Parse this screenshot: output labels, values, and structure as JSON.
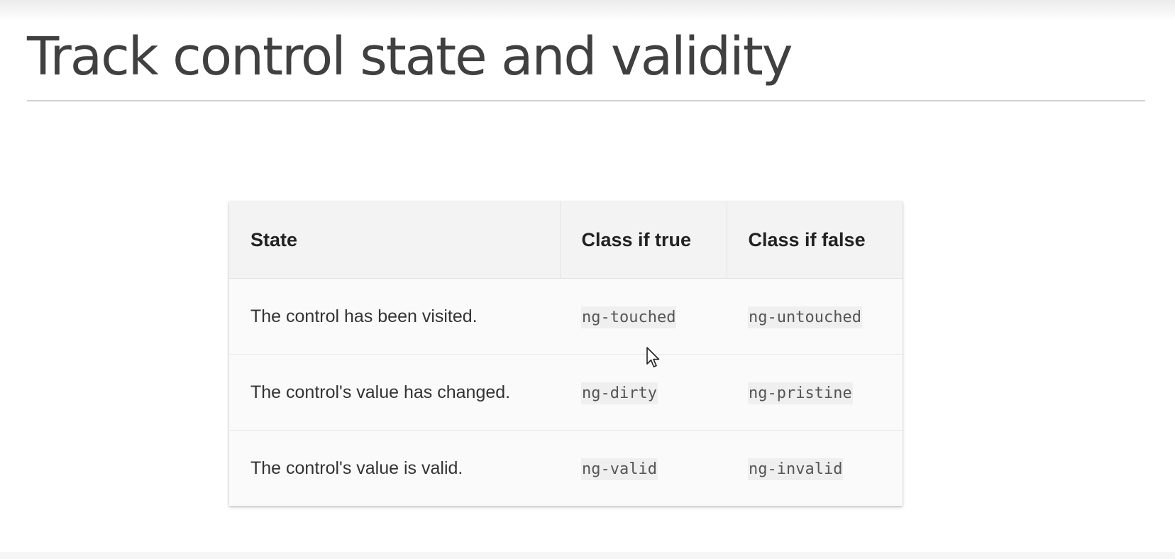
{
  "slide": {
    "title": "Track control state and validity"
  },
  "table": {
    "headers": [
      "State",
      "Class if true",
      "Class if false"
    ],
    "rows": [
      {
        "state": "The control has been visited.",
        "class_true": "ng-touched",
        "class_false": "ng-untouched"
      },
      {
        "state": "The control's value has changed.",
        "class_true": "ng-dirty",
        "class_false": "ng-pristine"
      },
      {
        "state": "The control's value is valid.",
        "class_true": "ng-valid",
        "class_false": "ng-invalid"
      }
    ]
  },
  "cursor": {
    "icon": "mouse-pointer-icon"
  }
}
